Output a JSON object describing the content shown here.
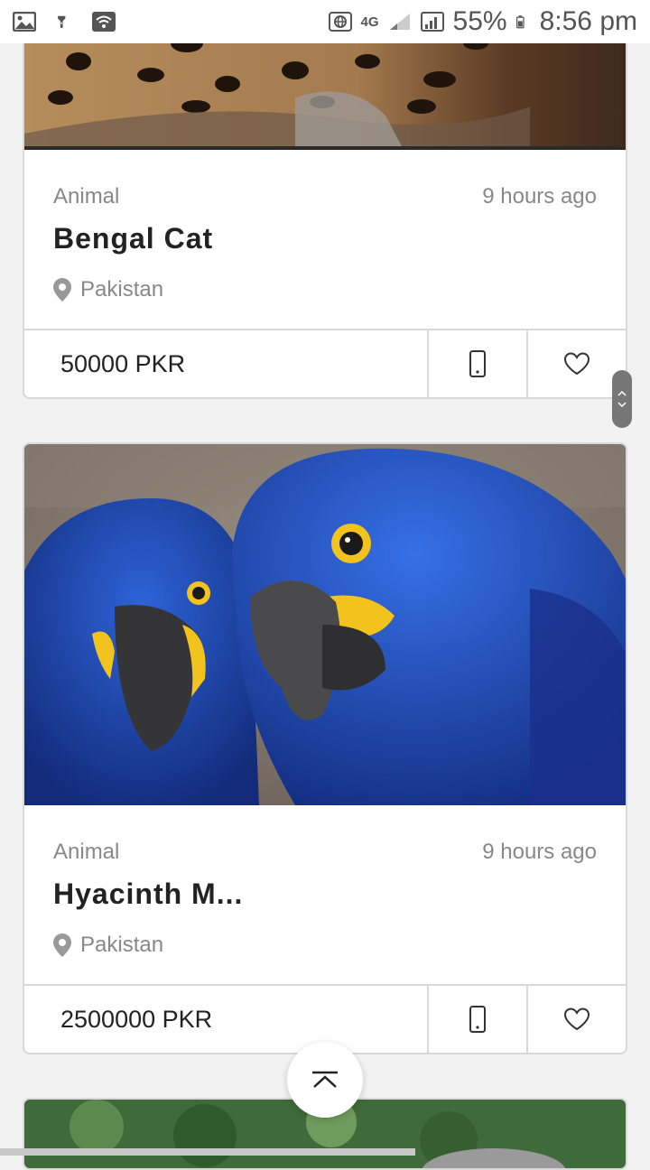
{
  "status_bar": {
    "network": "4G",
    "battery_percent": "55%",
    "time": "8:56 pm"
  },
  "listings": [
    {
      "category": "Animal",
      "time_ago": "9 hours ago",
      "title": "Bengal Cat",
      "location": "Pakistan",
      "price": "50000 PKR",
      "image_subject": "leopard-spotted cat fur"
    },
    {
      "category": "Animal",
      "time_ago": "9 hours ago",
      "title": "Hyacinth M...",
      "location": "Pakistan",
      "price": "2500000 PKR",
      "image_subject": "two blue hyacinth macaws"
    }
  ],
  "icons": {
    "phone": "phone-icon",
    "favorite": "heart-icon",
    "location": "location-pin-icon",
    "scroll_top": "chevron-up-icon"
  },
  "colors": {
    "background": "#f2f2f2",
    "card": "#ffffff",
    "border": "#d9d9d9",
    "muted_text": "#888888",
    "title_text": "#222222"
  }
}
